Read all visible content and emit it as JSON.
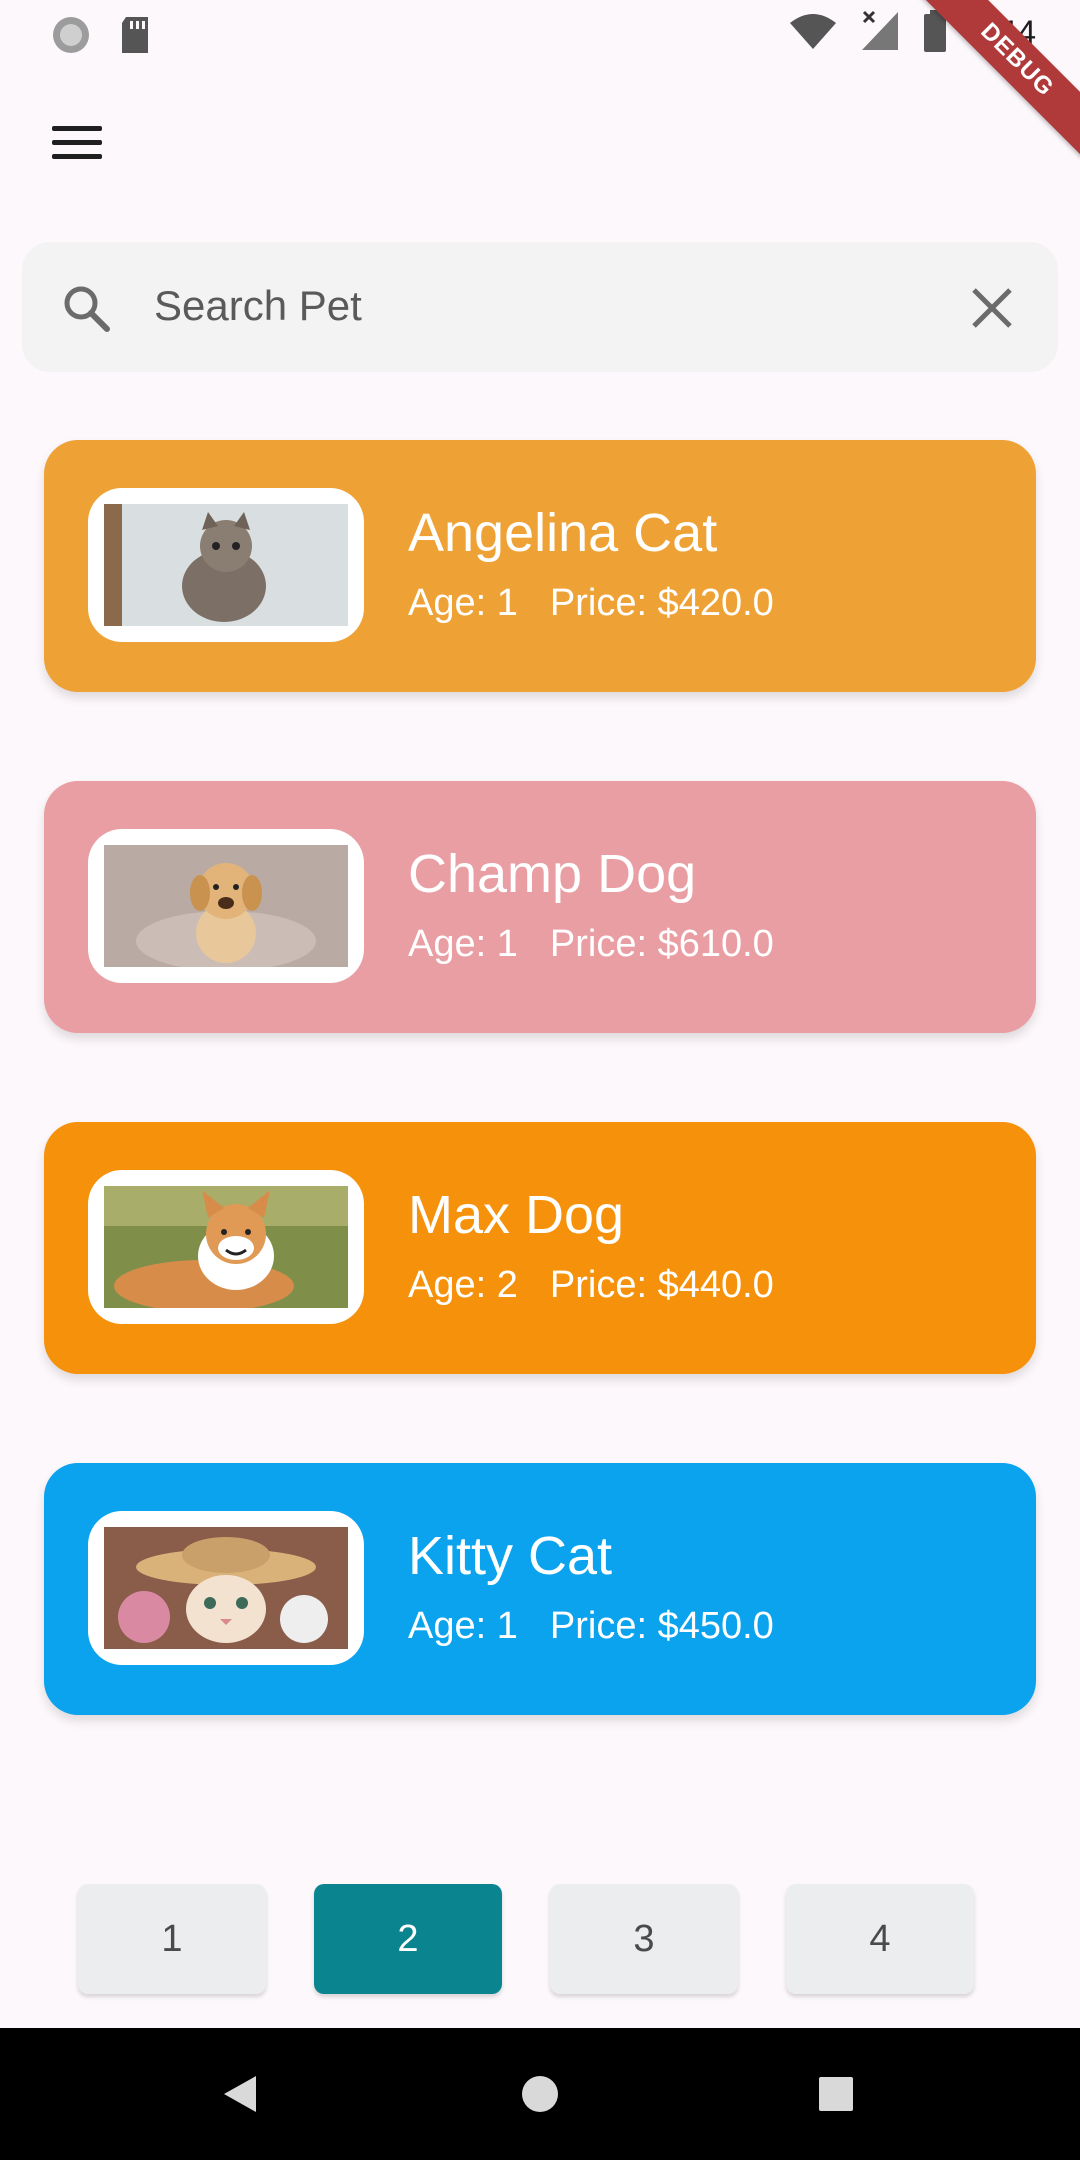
{
  "status_bar": {
    "time": "7:44",
    "left_icons": [
      "sync-icon",
      "sd-card-icon"
    ],
    "right_icons": [
      "wifi-icon",
      "signal-icon",
      "battery-icon"
    ]
  },
  "debug_banner": "DEBUG",
  "search": {
    "placeholder": "Search Pet"
  },
  "pets": [
    {
      "name": "Angelina Cat",
      "age": "Age: 1",
      "price": "Price: $420.0",
      "color": "#eea236",
      "image": "kitten-photo"
    },
    {
      "name": "Champ Dog",
      "age": "Age: 1",
      "price": "Price: $610.0",
      "color": "#e89ea3",
      "image": "golden-puppy-photo"
    },
    {
      "name": "Max Dog",
      "age": "Age: 2",
      "price": "Price: $440.0",
      "color": "#f6910b",
      "image": "corgi-photo"
    },
    {
      "name": "Kitty Cat",
      "age": "Age: 1",
      "price": "Price: $450.0",
      "color": "#0ba3ee",
      "image": "kitten-hat-photo"
    }
  ],
  "pagination": {
    "pages": [
      "1",
      "2",
      "3",
      "4"
    ],
    "active": "2",
    "active_color": "#0a8590"
  },
  "nav_bar": {
    "icons": [
      "back-icon",
      "home-icon",
      "recents-icon"
    ]
  }
}
